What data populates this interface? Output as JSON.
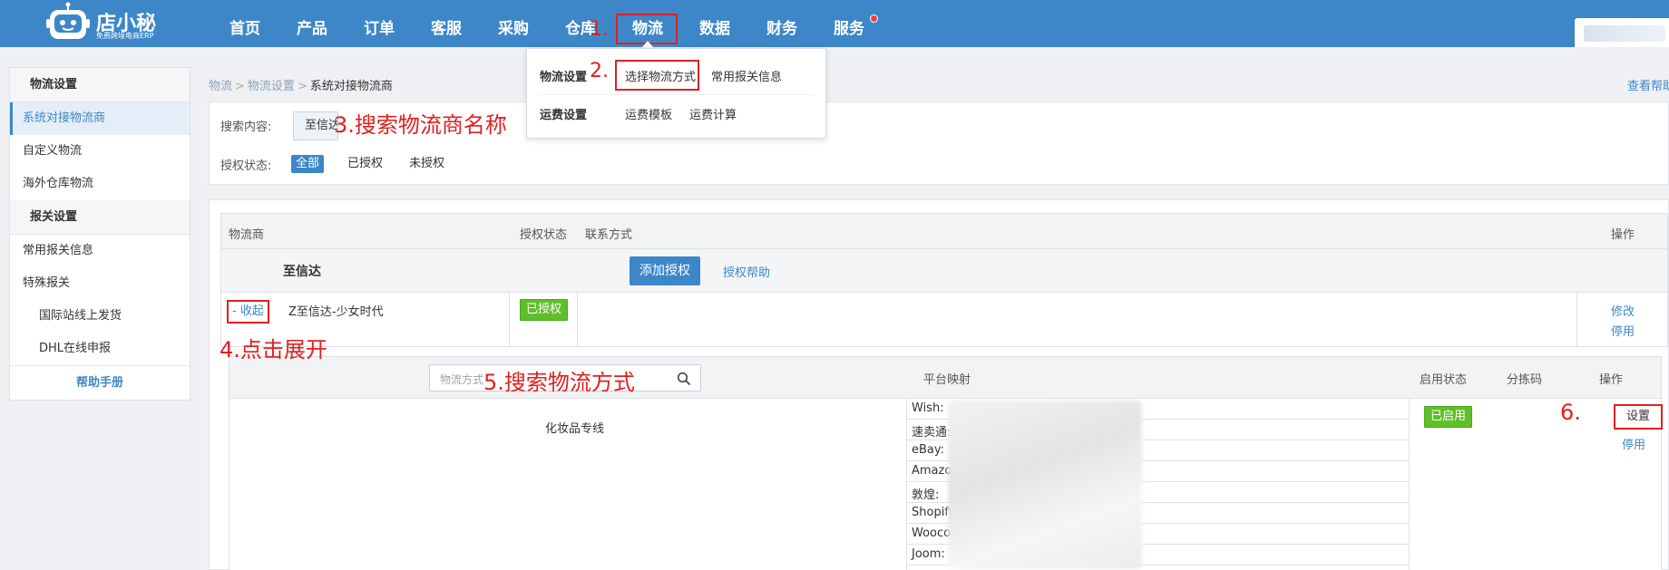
{
  "app": {
    "logo_name": "店小秘",
    "logo_sub": "免费跨境电商ERP"
  },
  "nav": {
    "items": [
      "首页",
      "产品",
      "订单",
      "客服",
      "采购",
      "仓库",
      "物流",
      "数据",
      "财务",
      "服务"
    ],
    "active": "物流"
  },
  "sidebar": {
    "groups": [
      {
        "title": "物流设置",
        "items": [
          "系统对接物流商",
          "自定义物流",
          "海外仓库物流"
        ]
      },
      {
        "title": "报关设置",
        "items": [
          "常用报关信息",
          "特殊报关",
          "国际站线上发货",
          "DHL在线申报"
        ]
      }
    ],
    "active_item": "系统对接物流商",
    "help": "帮助手册"
  },
  "breadcrumb": {
    "items": [
      "物流",
      "物流设置",
      "系统对接物流商"
    ],
    "sep": ">",
    "help_link": "查看帮助"
  },
  "dropdown": {
    "row1_title": "物流设置",
    "row1_items": [
      "选择物流方式",
      "常用报关信息"
    ],
    "row2_title": "运费设置",
    "row2_items": [
      "运费模板",
      "运费计算"
    ]
  },
  "search": {
    "content_label": "搜索内容:",
    "content_value": "至信达",
    "status_label": "授权状态:",
    "filters": [
      "全部",
      "已授权",
      "未授权"
    ],
    "active_filter": "全部"
  },
  "table": {
    "headers": {
      "carrier": "物流商",
      "auth_status": "授权状态",
      "contact": "联系方式",
      "ops": "操作"
    },
    "carrier": {
      "name": "至信达",
      "add_auth": "添加授权",
      "auth_help": "授权帮助"
    },
    "account": {
      "toggle": "- 收起",
      "name": "Z至信达-少女时代",
      "status": "已授权",
      "ops": [
        "修改",
        "停用"
      ]
    }
  },
  "sub_table": {
    "search_placeholder": "物流方式",
    "headers": {
      "mapping": "平台映射",
      "enabled": "启用状态",
      "sort_code": "分拣码",
      "ops": "操作"
    },
    "row": {
      "method": "化妆品专线",
      "platforms": [
        "Wish:",
        "速卖通:",
        "eBay:",
        "Amazon",
        "敦煌:",
        "Shopify",
        "Woocor",
        "Joom:"
      ],
      "enabled": "已启用",
      "ops": [
        "设置",
        "停用"
      ]
    }
  },
  "annotations": {
    "a1": "1.",
    "a2": "2.",
    "a3": "3.搜索物流商名称",
    "a4": "4.点击展开",
    "a5": "5.搜索物流方式",
    "a6": "6."
  },
  "colors": {
    "brand": "#3d87c9",
    "annotation": "#e02020",
    "enabled_badge": "#5fbf2a"
  }
}
